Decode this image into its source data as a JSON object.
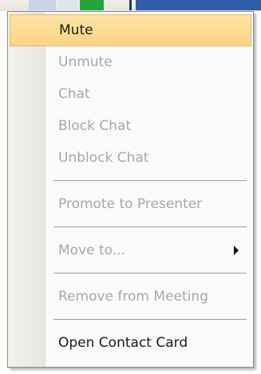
{
  "menu": {
    "mute": "Mute",
    "unmute": "Unmute",
    "chat": "Chat",
    "block_chat": "Block Chat",
    "unblock_chat": "Unblock Chat",
    "promote_to_presenter": "Promote to Presenter",
    "move_to": "Move to...",
    "remove_from_meeting": "Remove from Meeting",
    "open_contact_card": "Open Contact Card"
  },
  "colors": {
    "highlight": "#fbd383",
    "disabled_text": "#a8a8a8",
    "enabled_text": "#1b1b1b"
  },
  "icons": {
    "submenu": "chevron-right-icon"
  }
}
